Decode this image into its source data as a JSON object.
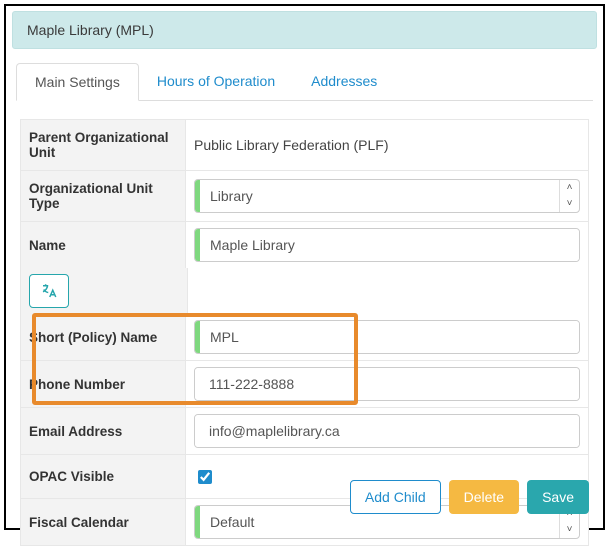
{
  "header": {
    "title": "Maple Library (MPL)"
  },
  "tabs": {
    "main": "Main Settings",
    "hours": "Hours of Operation",
    "addresses": "Addresses"
  },
  "fields": {
    "parent_label": "Parent Organizational Unit",
    "parent_value": "Public Library Federation (PLF)",
    "type_label": "Organizational Unit Type",
    "type_value": "Library",
    "name_label": "Name",
    "name_value": "Maple Library",
    "short_label": "Short (Policy) Name",
    "short_value": "MPL",
    "phone_label": "Phone Number",
    "phone_value": "111-222-8888",
    "email_label": "Email Address",
    "email_value": "info@maplelibrary.ca",
    "opac_label": "OPAC Visible",
    "opac_checked": true,
    "fiscal_label": "Fiscal Calendar",
    "fiscal_value": "Default"
  },
  "buttons": {
    "add_child": "Add Child",
    "delete": "Delete",
    "save": "Save"
  }
}
